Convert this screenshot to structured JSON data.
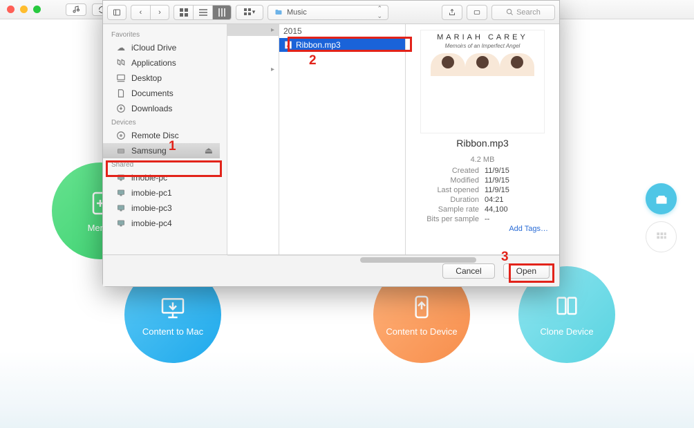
{
  "toolbar": {
    "path_folder": "Music",
    "search_placeholder": "Search"
  },
  "sidebar": {
    "sections": [
      {
        "title": "Favorites",
        "items": [
          {
            "label": "iCloud Drive",
            "icon": "cloud"
          },
          {
            "label": "Applications",
            "icon": "apps"
          },
          {
            "label": "Desktop",
            "icon": "desktop"
          },
          {
            "label": "Documents",
            "icon": "doc"
          },
          {
            "label": "Downloads",
            "icon": "download"
          }
        ]
      },
      {
        "title": "Devices",
        "items": [
          {
            "label": "Remote Disc",
            "icon": "disc"
          },
          {
            "label": "Samsung",
            "icon": "drive",
            "selected": true,
            "ejectable": true
          }
        ]
      },
      {
        "title": "Shared",
        "items": [
          {
            "label": "imobie-pc",
            "icon": "display"
          },
          {
            "label": "imobie-pc1",
            "icon": "display"
          },
          {
            "label": "imobie-pc3",
            "icon": "display"
          },
          {
            "label": "imobie-pc4",
            "icon": "display"
          }
        ]
      }
    ]
  },
  "columns": {
    "col1": [
      {
        "label": "2015",
        "folder": true,
        "selected": true
      },
      {
        "label": "",
        "folder": true
      }
    ],
    "col2": [
      {
        "label": "Ribbon.mp3",
        "selected": true
      }
    ]
  },
  "preview": {
    "artist_line1": "MARIAH CAREY",
    "artist_line2": "Memoirs of an Imperfect Angel",
    "filename": "Ribbon.mp3",
    "size": "4.2 MB",
    "meta": [
      {
        "k": "Created",
        "v": "11/9/15"
      },
      {
        "k": "Modified",
        "v": "11/9/15"
      },
      {
        "k": "Last opened",
        "v": "11/9/15"
      },
      {
        "k": "Duration",
        "v": "04:21"
      },
      {
        "k": "Sample rate",
        "v": "44,100"
      },
      {
        "k": "Bits per sample",
        "v": "--"
      }
    ],
    "add_tags": "Add Tags…"
  },
  "footer": {
    "cancel": "Cancel",
    "open": "Open"
  },
  "bg_circles": {
    "c1": "Merge",
    "c2": "Content to Mac",
    "c3": "Content to Device",
    "c4": "Clone Device"
  },
  "annotations": {
    "n1": "1",
    "n2": "2",
    "n3": "3"
  }
}
